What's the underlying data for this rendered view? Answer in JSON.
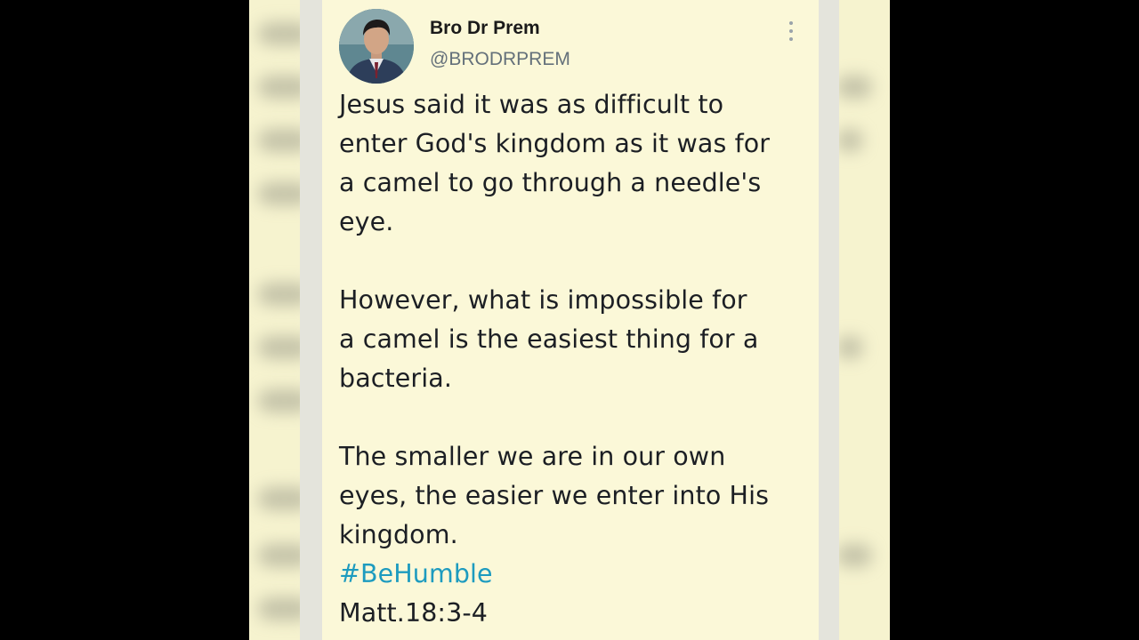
{
  "tweet": {
    "display_name": "Bro Dr Prem",
    "handle": "@BRODRPREM",
    "paragraphs": [
      "Jesus said it was as difficult to\nenter God's kingdom as it was for\na camel to go through a needle's\neye.",
      "However, what is impossible for\na camel is the easiest thing for a\nbacteria.",
      "The smaller we are in our own\neyes, the easier we enter into His\nkingdom."
    ],
    "hashtag": "#BeHumble",
    "reference": "Matt.18:3-4"
  },
  "icons": {
    "avatar": "profile-photo",
    "more": "more-vertical-icon"
  },
  "colors": {
    "background": "#000000",
    "card": "#fbf8d8",
    "text": "#1c1f24",
    "handle": "#64707a",
    "hashtag": "#1d9bbf"
  }
}
